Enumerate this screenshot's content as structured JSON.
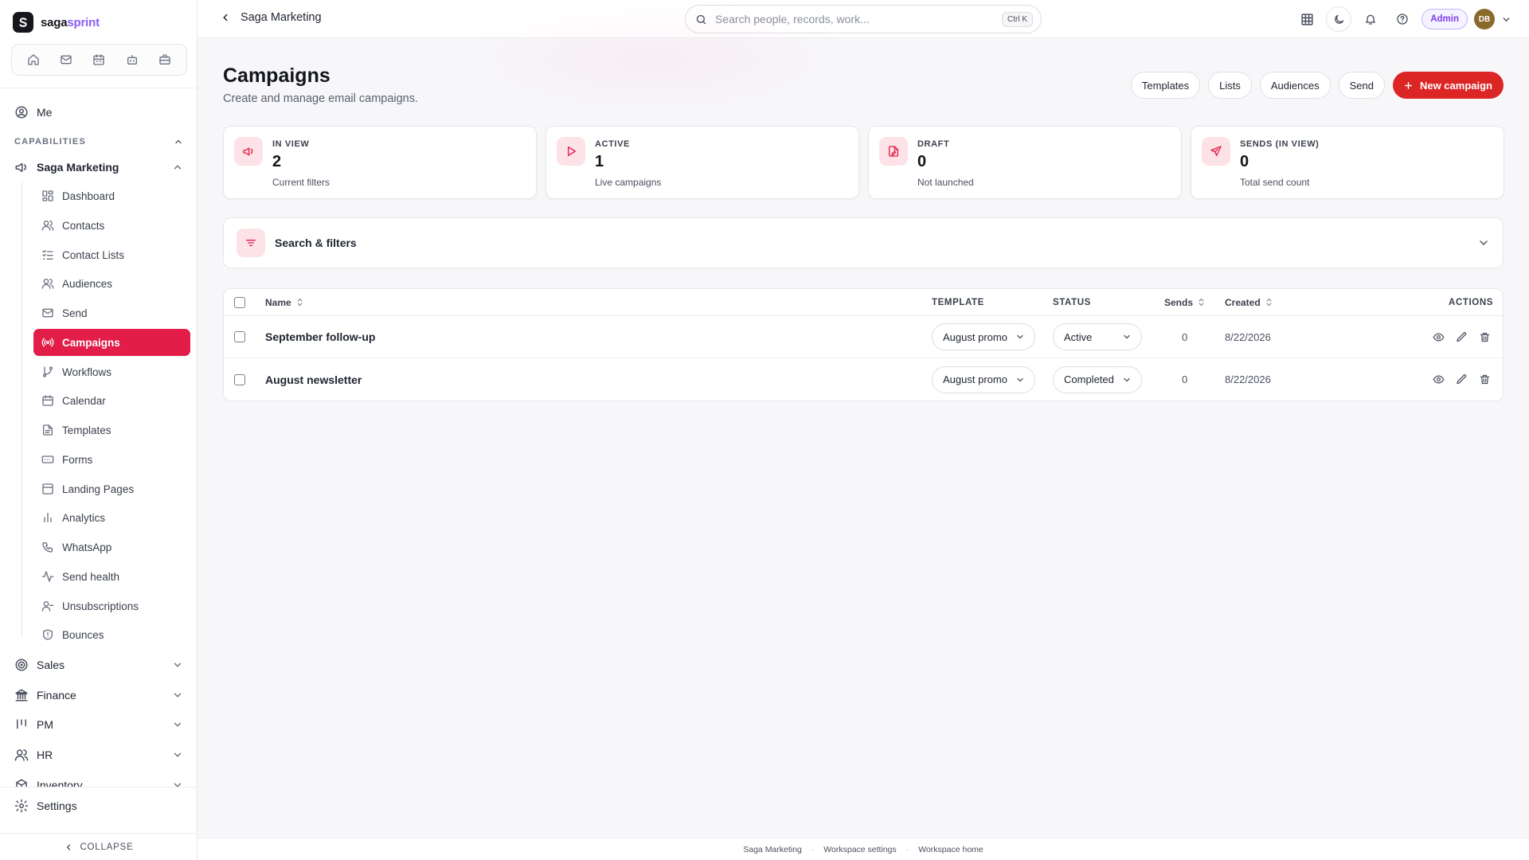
{
  "brand": {
    "name_prefix": "saga",
    "name_suffix": "sprint"
  },
  "sidebar": {
    "me_label": "Me",
    "capabilities_label": "CAPABILITIES",
    "group_marketing": "Saga Marketing",
    "items": [
      {
        "label": "Dashboard",
        "icon": "dashboard-icon"
      },
      {
        "label": "Contacts",
        "icon": "users-icon"
      },
      {
        "label": "Contact Lists",
        "icon": "list-check-icon"
      },
      {
        "label": "Audiences",
        "icon": "users-icon"
      },
      {
        "label": "Send",
        "icon": "mail-icon"
      },
      {
        "label": "Campaigns",
        "icon": "broadcast-icon",
        "active": true
      },
      {
        "label": "Workflows",
        "icon": "git-branch-icon"
      },
      {
        "label": "Calendar",
        "icon": "calendar-icon"
      },
      {
        "label": "Templates",
        "icon": "file-text-icon"
      },
      {
        "label": "Forms",
        "icon": "form-input-icon"
      },
      {
        "label": "Landing Pages",
        "icon": "layout-icon"
      },
      {
        "label": "Analytics",
        "icon": "bar-chart-icon"
      },
      {
        "label": "WhatsApp",
        "icon": "phone-icon"
      },
      {
        "label": "Send health",
        "icon": "activity-icon"
      },
      {
        "label": "Unsubscriptions",
        "icon": "user-minus-icon"
      },
      {
        "label": "Bounces",
        "icon": "shield-icon"
      }
    ],
    "groups": [
      {
        "label": "Sales",
        "icon": "target-icon"
      },
      {
        "label": "Finance",
        "icon": "bank-icon"
      },
      {
        "label": "PM",
        "icon": "kanban-icon"
      },
      {
        "label": "HR",
        "icon": "users-icon"
      },
      {
        "label": "Inventory",
        "icon": "box-icon"
      }
    ],
    "settings_label": "Settings",
    "collapse_label": "COLLAPSE"
  },
  "topbar": {
    "breadcrumb": "Saga Marketing",
    "search_placeholder": "Search people, records, work...",
    "search_shortcut": "Ctrl K",
    "role_badge": "Admin",
    "avatar_initials": "DB"
  },
  "page": {
    "title": "Campaigns",
    "subtitle": "Create and manage email campaigns.",
    "actions": [
      "Templates",
      "Lists",
      "Audiences",
      "Send"
    ],
    "primary_action": "New campaign"
  },
  "stats": [
    {
      "label": "IN VIEW",
      "value": "2",
      "note": "Current filters",
      "icon": "megaphone-icon"
    },
    {
      "label": "ACTIVE",
      "value": "1",
      "note": "Live campaigns",
      "icon": "play-icon"
    },
    {
      "label": "DRAFT",
      "value": "0",
      "note": "Not launched",
      "icon": "file-pen-icon"
    },
    {
      "label": "SENDS (IN VIEW)",
      "value": "0",
      "note": "Total send count",
      "icon": "send-icon"
    }
  ],
  "filters": {
    "label": "Search & filters"
  },
  "table": {
    "columns": {
      "name": "Name",
      "template": "TEMPLATE",
      "status": "STATUS",
      "sends": "Sends",
      "created": "Created",
      "actions": "ACTIONS"
    },
    "rows": [
      {
        "name": "September follow-up",
        "template": "August promo",
        "status": "Active",
        "sends": "0",
        "created": "8/22/2026"
      },
      {
        "name": "August newsletter",
        "template": "August promo",
        "status": "Completed",
        "sends": "0",
        "created": "8/22/2026"
      }
    ]
  },
  "footer": {
    "links": [
      "Saga Marketing",
      "Workspace settings",
      "Workspace home"
    ]
  },
  "colors": {
    "accent": "#e11d48",
    "primary_button": "#dc2626",
    "admin": "#7c3aed"
  }
}
